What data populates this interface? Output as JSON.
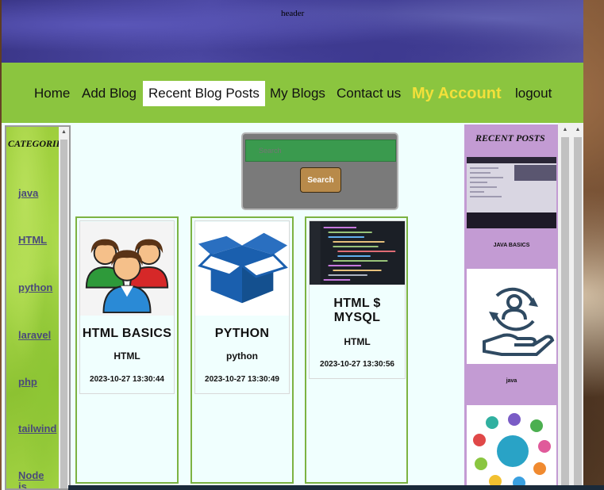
{
  "header": {
    "text": "header"
  },
  "nav": {
    "items": [
      {
        "label": "Home"
      },
      {
        "label": "Add Blog"
      },
      {
        "label": "Recent Blog Posts"
      },
      {
        "label": "My Blogs"
      },
      {
        "label": "Contact us"
      },
      {
        "label": "My Account"
      },
      {
        "label": "logout"
      }
    ],
    "active": "Recent Blog Posts"
  },
  "sidebar": {
    "title": "CATEGORIES",
    "categories": [
      "java",
      "HTML",
      "python",
      "laravel",
      "php",
      "tailwind",
      "Node js"
    ]
  },
  "search": {
    "placeholder": "Search",
    "button_label": "Search"
  },
  "posts": [
    {
      "title": "HTML BASICS",
      "category": "HTML",
      "date": "2023-10-27 13:30:44",
      "image": "users-group-icon"
    },
    {
      "title": "PYTHON",
      "category": "python",
      "date": "2023-10-27 13:30:49",
      "image": "open-box-icon"
    },
    {
      "title": "HTML $ MYSQL",
      "category": "HTML",
      "date": "2023-10-27 13:30:56",
      "image": "code-screen-image"
    }
  ],
  "recent_posts": {
    "title": "RECENT POSTS",
    "items": [
      {
        "label": "JAVA BASICS",
        "image": "laptop-terminal-image"
      },
      {
        "label": "java",
        "image": "user-cycle-hand-icon"
      },
      {
        "label": "",
        "image": "event-success-diagram"
      }
    ]
  },
  "colors": {
    "nav_bg": "#8bc53f",
    "account": "#f2e03a",
    "card_border": "#7cb342",
    "recent_bg": "#c39bd3",
    "search_input": "#3a9a4e",
    "search_button": "#b88a4a"
  }
}
